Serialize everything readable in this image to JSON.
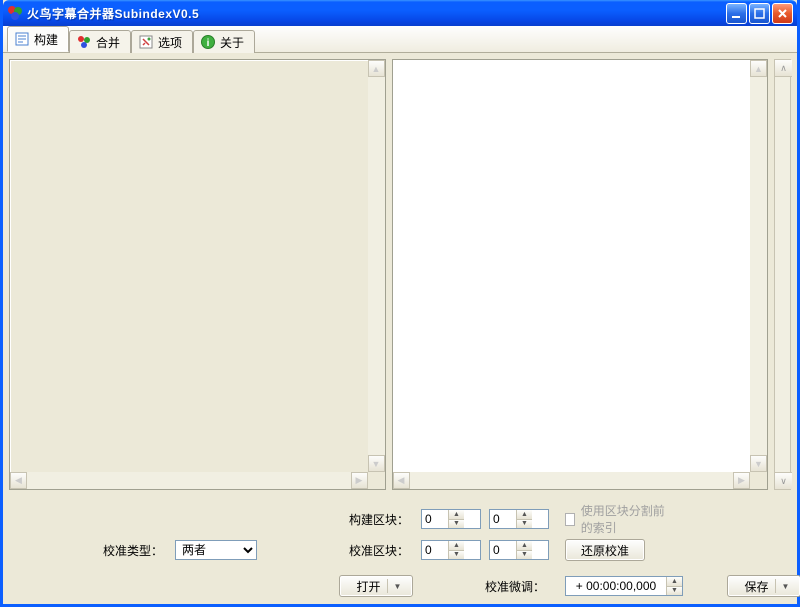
{
  "window": {
    "title": "火鸟字幕合并器SubindexV0.5"
  },
  "tabs": [
    {
      "label": "构建",
      "icon": "build-icon"
    },
    {
      "label": "合并",
      "icon": "merge-icon"
    },
    {
      "label": "选项",
      "icon": "options-icon"
    },
    {
      "label": "关于",
      "icon": "about-icon"
    }
  ],
  "controls": {
    "build_block_label": "构建区块：",
    "build_block_value1": "0",
    "build_block_value2": "0",
    "use_presplit_index_label": "使用区块分割前的索引",
    "calib_type_label": "校准类型：",
    "calib_type_options": [
      "两者"
    ],
    "calib_type_value": "两者",
    "calib_block_label": "校准区块：",
    "calib_block_value1": "0",
    "calib_block_value2": "0",
    "restore_calib_label": "还原校准",
    "open_label": "打开",
    "calib_fine_label": "校准微调：",
    "calib_fine_value": "+ 00:00:00,000",
    "save_label": "保存"
  }
}
